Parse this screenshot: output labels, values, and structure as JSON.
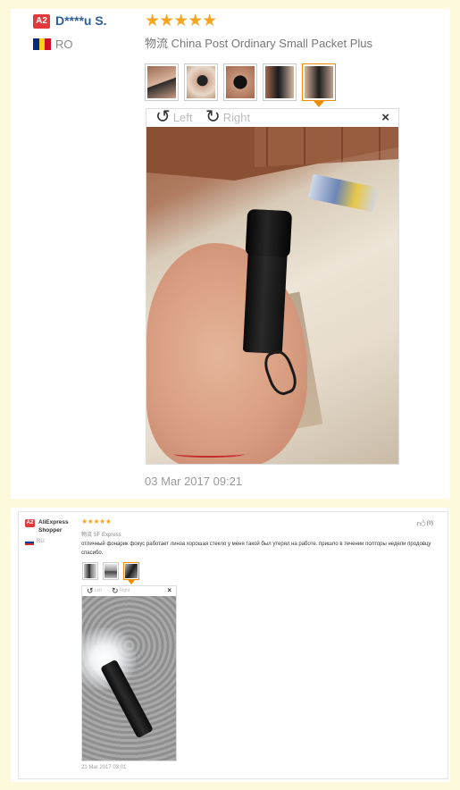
{
  "review1": {
    "badge": "A2",
    "name": "D****u S.",
    "flag_colors": [
      "#002b7f",
      "#fcd116",
      "#ce1126"
    ],
    "country": "RO",
    "rating": 5,
    "stars": "★★★★★",
    "shipping": "物流 China Post Ordinary Small Packet Plus",
    "thumbnails": [
      {
        "label": "photo-1",
        "active": false
      },
      {
        "label": "photo-2",
        "active": false
      },
      {
        "label": "photo-3",
        "active": false
      },
      {
        "label": "photo-4",
        "active": false
      },
      {
        "label": "photo-5",
        "active": true
      }
    ],
    "viewer": {
      "rotate_left_icon": "rotate-left-icon",
      "rotate_left_label": "Left",
      "rotate_right_icon": "rotate-right-icon",
      "rotate_right_label": "Right",
      "close_icon": "close-icon",
      "close_glyph": "×"
    },
    "date": "03 Mar 2017 09:21"
  },
  "review2": {
    "badge": "A2",
    "name": "AliExpress Shopper",
    "flag_colors": [
      "#ffffff",
      "#0039a6",
      "#d52b1e"
    ],
    "country": "RU",
    "rating": 5,
    "stars": "★★★★★",
    "shipping": "物流 SF Express",
    "text": "отличный фонарик фокус работает линза хорошая стекло у меня такой был утерял на работе. пришло в течении полторы недели продовцу спасибо.",
    "likes": "(0)",
    "like_icon": "thumbs-up-icon",
    "thumbnails": [
      {
        "label": "photo-1",
        "active": false
      },
      {
        "label": "photo-2",
        "active": false
      },
      {
        "label": "photo-3",
        "active": true
      }
    ],
    "viewer": {
      "rotate_left_label": "Left",
      "rotate_right_label": "Right",
      "close_glyph": "×"
    },
    "date": "21 Mar 2017 03:01"
  },
  "colors": {
    "page_background": "#fdf9dc",
    "star": "#f5a623",
    "badge": "#e4393c",
    "name_link": "#2f5f99",
    "active_thumb": "#f08c00"
  }
}
